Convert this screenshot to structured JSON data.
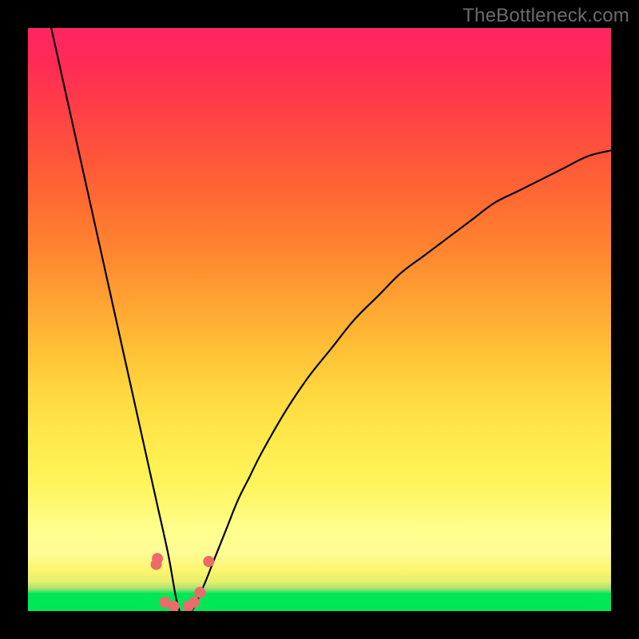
{
  "watermark": "TheBottleneck.com",
  "chart_data": {
    "type": "line",
    "title": "",
    "xlabel": "",
    "ylabel": "",
    "xlim": [
      0,
      100
    ],
    "ylim": [
      0,
      100
    ],
    "note": "V-shaped curve; y expressed as percent of plot height from bottom. Minimum ~0 at x≈26; rises steeply toward left edge and gradually toward right.",
    "series": [
      {
        "name": "curve",
        "x": [
          4,
          6,
          8,
          10,
          12,
          14,
          16,
          18,
          20,
          22,
          24,
          26,
          28,
          30,
          32,
          34,
          36,
          38,
          40,
          44,
          48,
          52,
          56,
          60,
          64,
          68,
          72,
          76,
          80,
          84,
          88,
          92,
          96,
          100
        ],
        "y": [
          100,
          91,
          82,
          73,
          64,
          55,
          46,
          37,
          28,
          19,
          10,
          0,
          0,
          4,
          9,
          14,
          19,
          23,
          27,
          34,
          40,
          45,
          50,
          54,
          58,
          61,
          64,
          67,
          70,
          72,
          74,
          76,
          78,
          79
        ]
      }
    ],
    "markers": {
      "name": "bottom-cluster",
      "points": [
        {
          "x": 22.2,
          "y": 9.0
        },
        {
          "x": 22.0,
          "y": 8.0
        },
        {
          "x": 23.5,
          "y": 1.5
        },
        {
          "x": 25.0,
          "y": 0.8
        },
        {
          "x": 27.5,
          "y": 0.8
        },
        {
          "x": 28.5,
          "y": 1.5
        },
        {
          "x": 29.5,
          "y": 3.2
        },
        {
          "x": 31.0,
          "y": 8.5
        }
      ],
      "radius_px": 7
    },
    "gradient_stops": [
      {
        "pos": 0.0,
        "color": "#00e756"
      },
      {
        "pos": 0.04,
        "color": "#b3e36e"
      },
      {
        "pos": 0.1,
        "color": "#fffc95"
      },
      {
        "pos": 0.3,
        "color": "#ffe94a"
      },
      {
        "pos": 0.55,
        "color": "#ff9e32"
      },
      {
        "pos": 0.8,
        "color": "#ff5038"
      },
      {
        "pos": 1.0,
        "color": "#ff2562"
      }
    ]
  }
}
